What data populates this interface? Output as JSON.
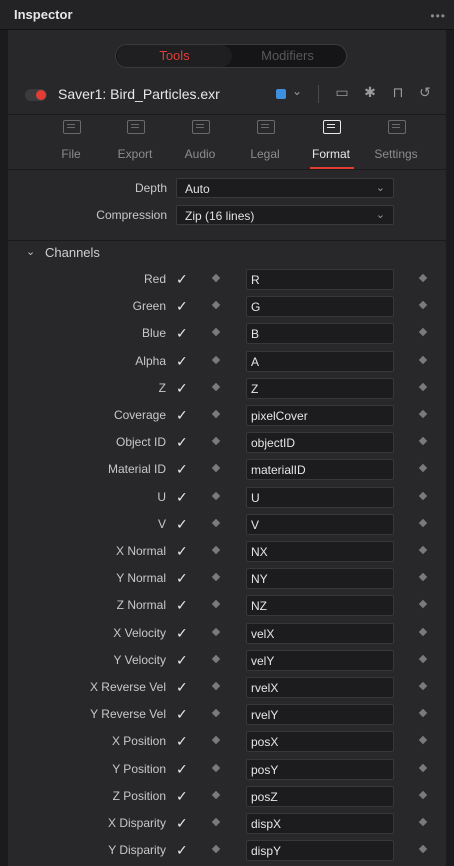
{
  "window": {
    "title": "Inspector"
  },
  "mode_tabs": {
    "active": "Tools",
    "inactive": "Modifiers"
  },
  "tool": {
    "name": "Saver1: Bird_Particles.exr"
  },
  "tabs": [
    {
      "label": "File",
      "active": false
    },
    {
      "label": "Export",
      "active": false
    },
    {
      "label": "Audio",
      "active": false
    },
    {
      "label": "Legal",
      "active": false
    },
    {
      "label": "Format",
      "active": true
    },
    {
      "label": "Settings",
      "active": false
    }
  ],
  "format": {
    "depth_label": "Depth",
    "depth_value": "Auto",
    "compression_label": "Compression",
    "compression_value": "Zip (16 lines)"
  },
  "section": {
    "title": "Channels"
  },
  "channels": [
    {
      "label": "Red",
      "value": "R"
    },
    {
      "label": "Green",
      "value": "G"
    },
    {
      "label": "Blue",
      "value": "B"
    },
    {
      "label": "Alpha",
      "value": "A"
    },
    {
      "label": "Z",
      "value": "Z"
    },
    {
      "label": "Coverage",
      "value": "pixelCover"
    },
    {
      "label": "Object ID",
      "value": "objectID"
    },
    {
      "label": "Material ID",
      "value": "materialID"
    },
    {
      "label": "U",
      "value": "U"
    },
    {
      "label": "V",
      "value": "V"
    },
    {
      "label": "X Normal",
      "value": "NX"
    },
    {
      "label": "Y Normal",
      "value": "NY"
    },
    {
      "label": "Z Normal",
      "value": "NZ"
    },
    {
      "label": "X Velocity",
      "value": "velX"
    },
    {
      "label": "Y Velocity",
      "value": "velY"
    },
    {
      "label": "X Reverse Vel",
      "value": "rvelX"
    },
    {
      "label": "Y Reverse Vel",
      "value": "rvelY"
    },
    {
      "label": "X Position",
      "value": "posX"
    },
    {
      "label": "Y Position",
      "value": "posY"
    },
    {
      "label": "Z Position",
      "value": "posZ"
    },
    {
      "label": "X Disparity",
      "value": "dispX"
    },
    {
      "label": "Y Disparity",
      "value": "dispY"
    }
  ],
  "colors": {
    "accent": "#e23c35",
    "tool_color": "#3f8fe0"
  },
  "icons": [
    "ellipsis-icon",
    "toggle-icon",
    "color-swatch",
    "chevron-down-icon",
    "collapse-icon",
    "pin-icon",
    "lock-icon",
    "reset-icon",
    "file-tab-icon",
    "export-tab-icon",
    "audio-tab-icon",
    "legal-tab-icon",
    "format-tab-icon",
    "settings-tab-icon",
    "keyframe-icon"
  ]
}
